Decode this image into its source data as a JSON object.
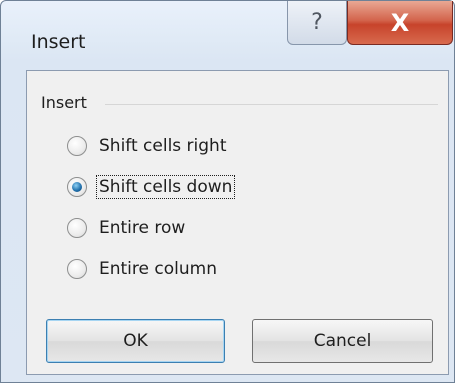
{
  "dialog": {
    "title": "Insert",
    "help_glyph": "?",
    "close_glyph": "X"
  },
  "group": {
    "label": "Insert",
    "options": [
      {
        "label": "Shift cells right",
        "checked": false
      },
      {
        "label": "Shift cells down",
        "checked": true
      },
      {
        "label": "Entire row",
        "checked": false
      },
      {
        "label": "Entire column",
        "checked": false
      }
    ]
  },
  "buttons": {
    "ok_label": "OK",
    "cancel_label": "Cancel"
  }
}
